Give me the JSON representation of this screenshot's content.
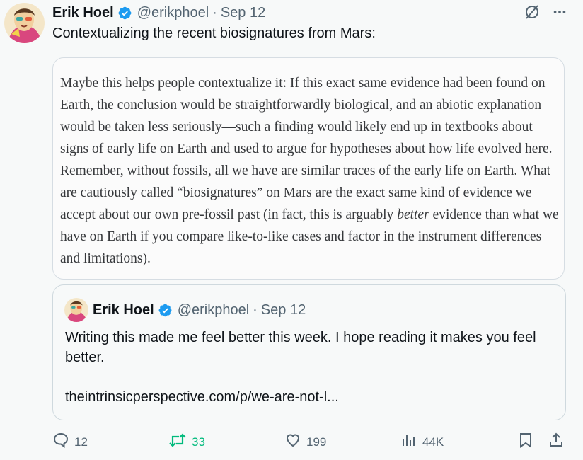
{
  "author": {
    "name": "Erik Hoel",
    "handle": "@erikphoel",
    "separator": "·",
    "date": "Sep 12"
  },
  "tweet": {
    "text": "Contextualizing the recent biosignatures from Mars:"
  },
  "quote_image": {
    "text_before": "Maybe this helps people contextualize it: If this exact same evidence had been found on Earth, the conclusion would be straightforwardly biological, and an abiotic explanation would be taken less seriously—such a finding would likely end up in textbooks about signs of early life on Earth and used to argue for hypotheses about how life evolved here. Remember, without fossils, all we have are similar traces of the early life on Earth. What are cautiously called “biosignatures” on Mars are the exact same kind of evidence we accept about our own pre-fossil past (in fact, this is arguably ",
    "emphasis": "better",
    "text_after": " evidence than what we have on Earth if you compare like-to-like cases and factor in the instrument differences and limitations)."
  },
  "quoted_tweet": {
    "name": "Erik Hoel",
    "handle": "@erikphoel",
    "separator": "·",
    "date": "Sep 12",
    "text": "Writing this made me feel better this week. I hope reading it makes you feel better.",
    "link": "theintrinsicperspective.com/p/we-are-not-l..."
  },
  "actions": {
    "replies": "12",
    "reposts": "33",
    "likes": "199",
    "views": "44K"
  },
  "colors": {
    "verified": "#1d9bf0",
    "repost_active": "#00ba7c",
    "muted": "#536471"
  },
  "icons": [
    "verified-badge-icon",
    "grok-icon",
    "more-icon",
    "reply-icon",
    "repost-icon",
    "like-icon",
    "views-icon",
    "bookmark-icon",
    "share-icon"
  ]
}
